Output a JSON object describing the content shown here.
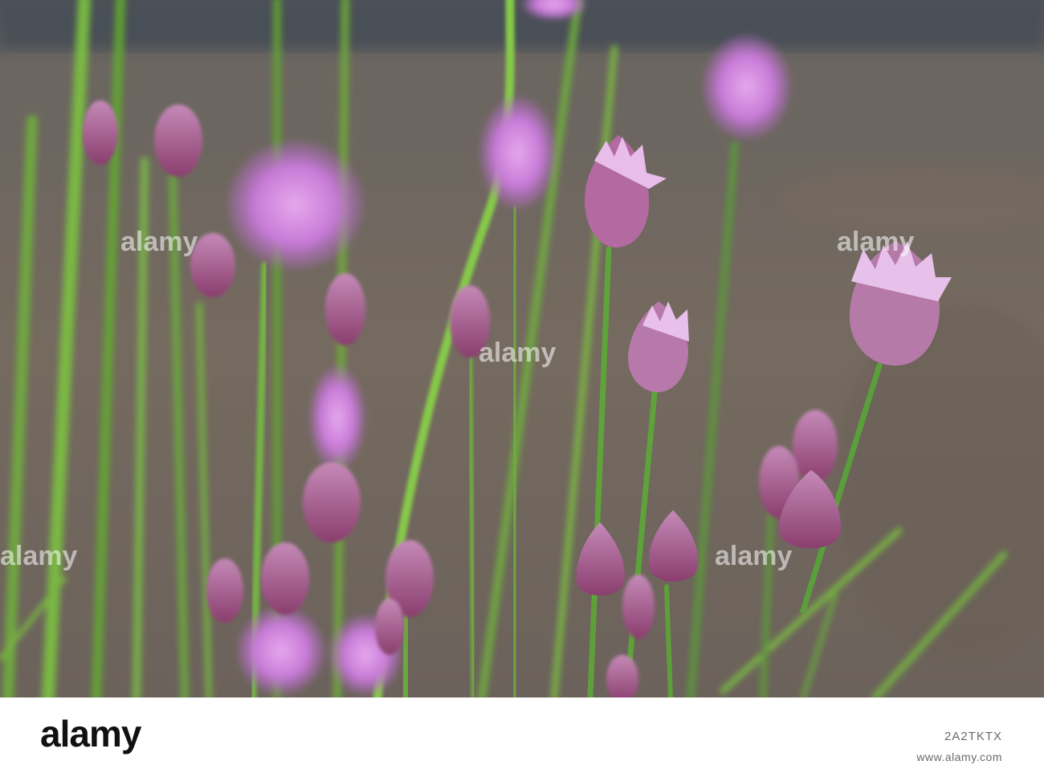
{
  "watermark": {
    "brand": "alamy",
    "small_brand": "alamy"
  },
  "footer": {
    "logo": "alamy",
    "image_id": "2A2TKTX",
    "url": "www.alamy.com"
  }
}
